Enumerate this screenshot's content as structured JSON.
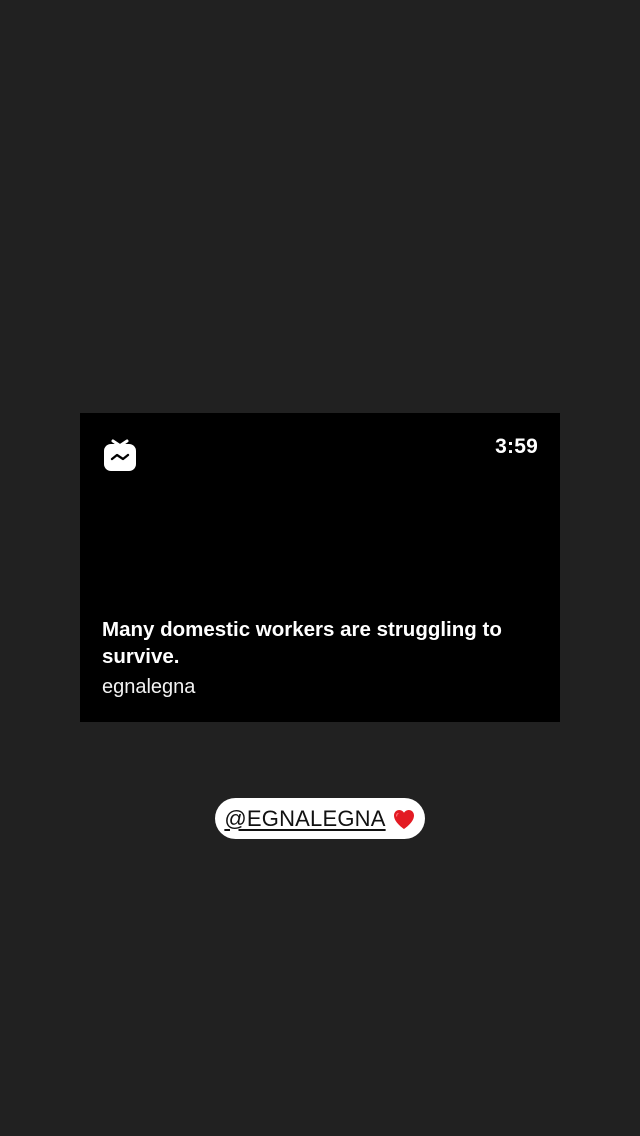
{
  "igtv_card": {
    "logo_icon": "igtv-logo-icon",
    "duration": "3:59",
    "caption": "Many domestic workers are struggling to survive.",
    "username": "egnalegna"
  },
  "mention_sticker": {
    "text": "@EGNALEGNA",
    "emoji_icon": "red-heart-icon",
    "emoji_color": "#e31b23"
  },
  "colors": {
    "background": "#212121",
    "card": "#000000",
    "sticker": "#ffffff"
  }
}
